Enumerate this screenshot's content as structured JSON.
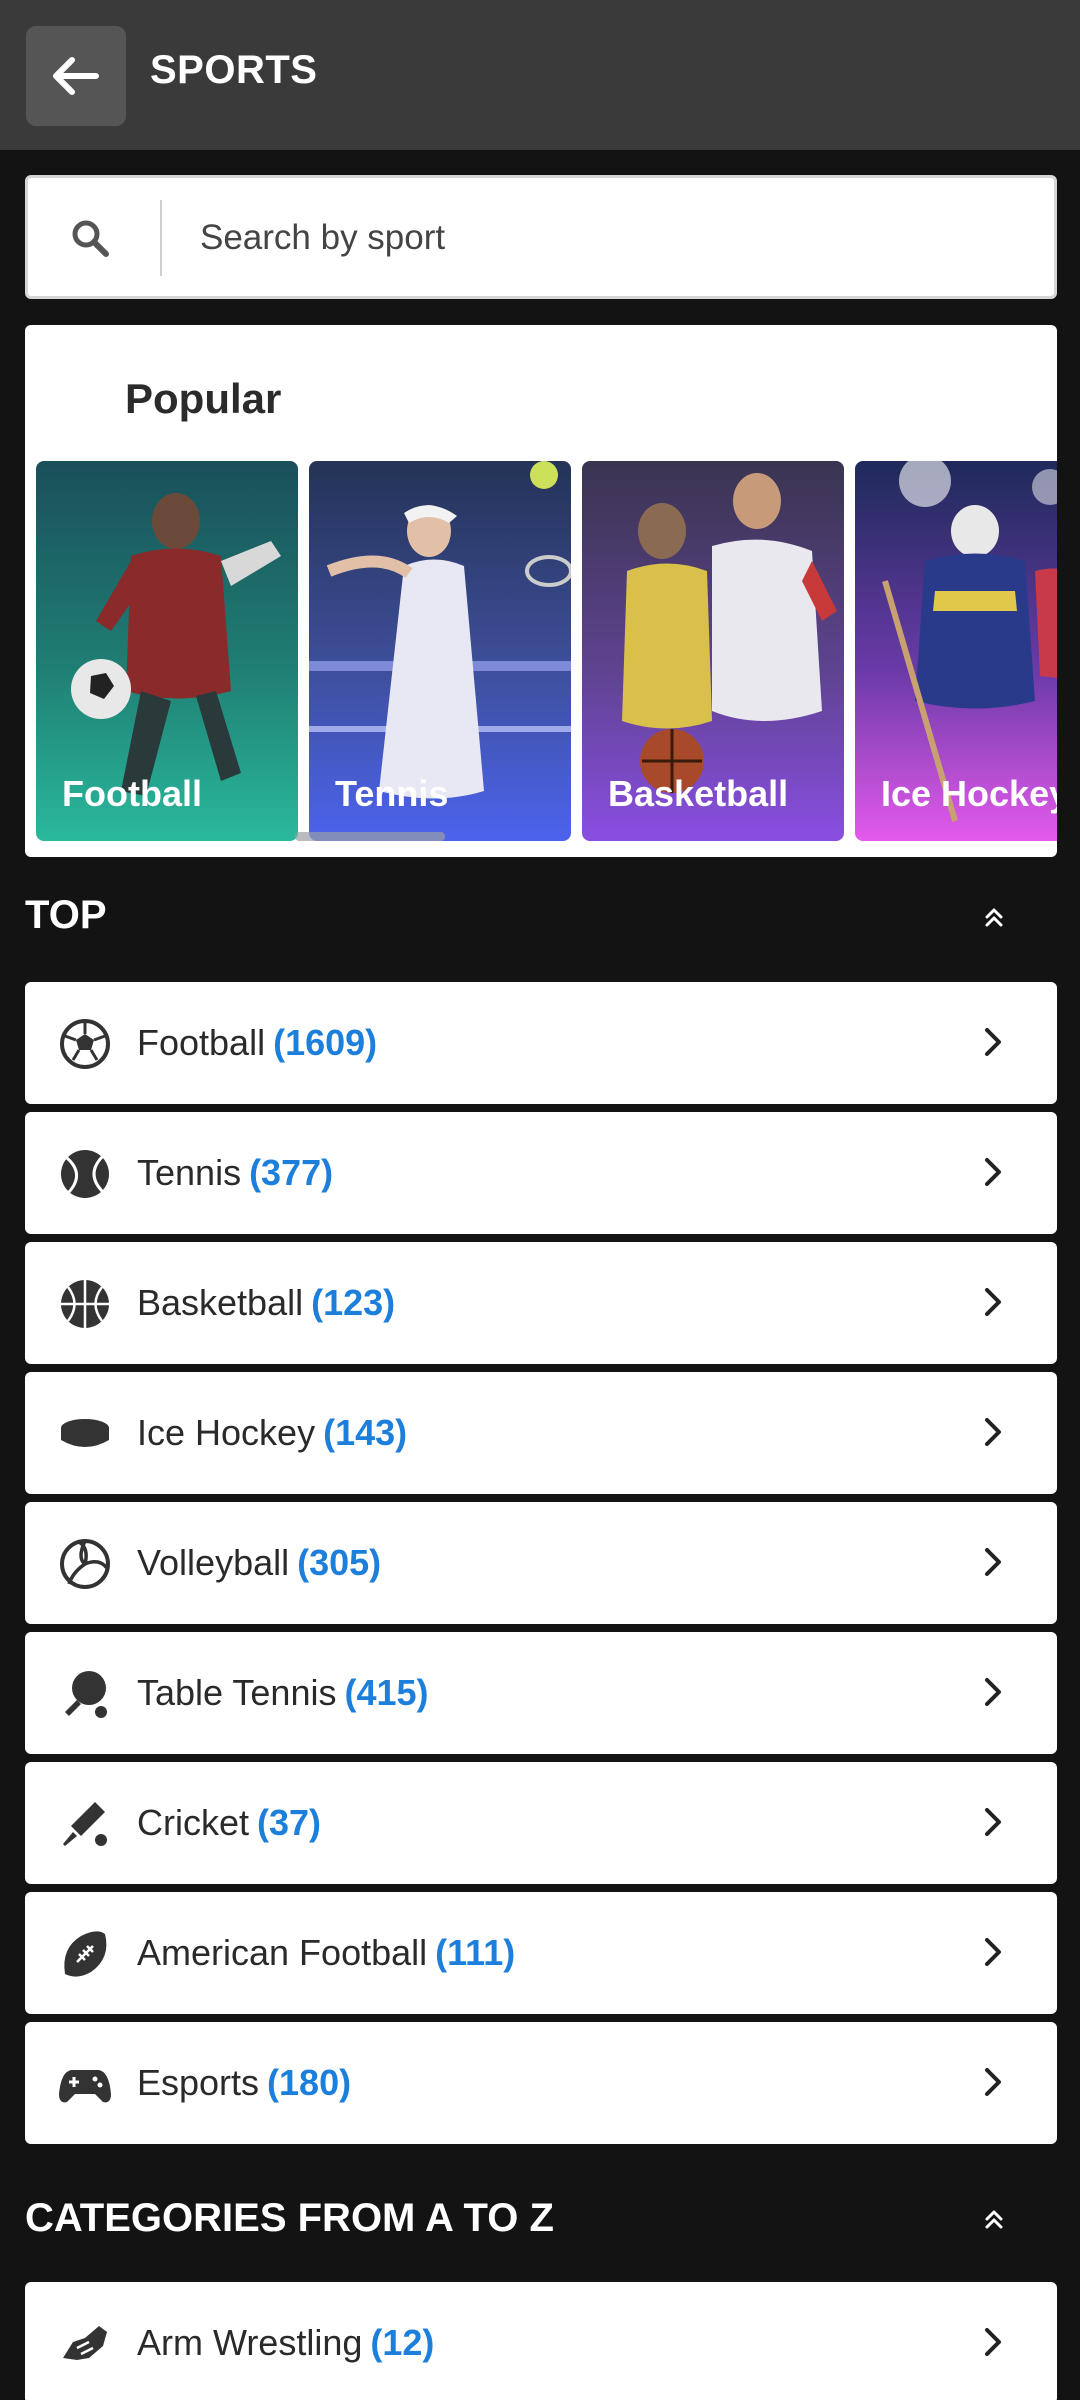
{
  "header": {
    "title": "SPORTS",
    "back_icon": "arrow-left-icon"
  },
  "search": {
    "placeholder": "Search by sport",
    "icon": "search-icon"
  },
  "popular": {
    "title": "Popular",
    "cards": [
      {
        "label": "Football",
        "color_top": "#1a5a52",
        "color_bottom": "#26b59a"
      },
      {
        "label": "Tennis",
        "color_top": "#3a4e9a",
        "color_bottom": "#4e6cf0"
      },
      {
        "label": "Basketball",
        "color_top": "#4b3a7a",
        "color_bottom": "#8b4ee0"
      },
      {
        "label": "Ice Hockey",
        "color_top": "#3a3a8a",
        "color_bottom": "#e05ae8"
      }
    ]
  },
  "top": {
    "title": "TOP",
    "items": [
      {
        "name": "Football",
        "count": "(1609)",
        "icon": "soccer-ball-icon"
      },
      {
        "name": "Tennis",
        "count": "(377)",
        "icon": "tennis-ball-icon"
      },
      {
        "name": "Basketball",
        "count": "(123)",
        "icon": "basketball-icon"
      },
      {
        "name": "Ice Hockey",
        "count": "(143)",
        "icon": "hockey-puck-icon"
      },
      {
        "name": "Volleyball",
        "count": "(305)",
        "icon": "volleyball-icon"
      },
      {
        "name": "Table Tennis",
        "count": "(415)",
        "icon": "ping-pong-paddle-icon"
      },
      {
        "name": "Cricket",
        "count": "(37)",
        "icon": "cricket-bat-icon"
      },
      {
        "name": "American Football",
        "count": "(111)",
        "icon": "american-football-icon"
      },
      {
        "name": "Esports",
        "count": "(180)",
        "icon": "gamepad-icon"
      }
    ]
  },
  "categories": {
    "title": "CATEGORIES FROM A TO Z",
    "items": [
      {
        "name": "Arm Wrestling",
        "count": "(12)",
        "icon": "arm-wrestling-icon"
      }
    ]
  },
  "colors": {
    "accent": "#1d7fdc",
    "header_bg": "#3a3a3a",
    "page_bg": "#131313"
  }
}
